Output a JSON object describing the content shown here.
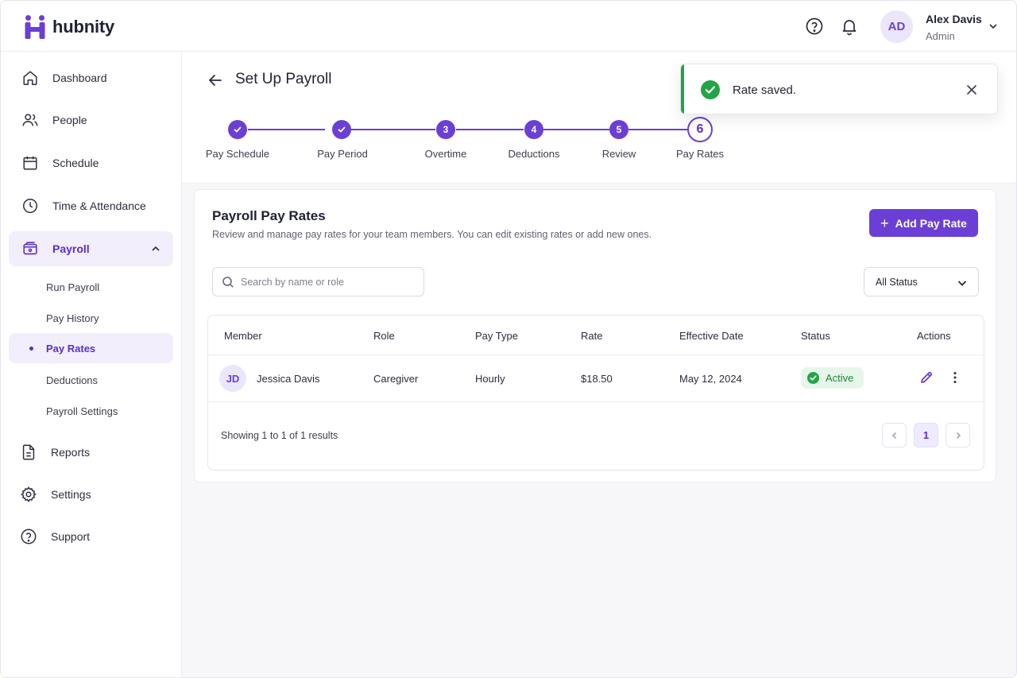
{
  "app": {
    "name": "hubnity",
    "brand_color": "#6b3fd6"
  },
  "header": {
    "help_icon": "help-circle-icon",
    "notification_icon": "bell-icon",
    "user": {
      "initials": "AD",
      "name": "Alex Davis",
      "role": "Admin"
    }
  },
  "sidebar": {
    "items": [
      {
        "label": "Dashboard",
        "icon": "home-icon"
      },
      {
        "label": "People",
        "icon": "users-icon"
      },
      {
        "label": "Schedule",
        "icon": "calendar-icon"
      },
      {
        "label": "Time & Attendance",
        "icon": "clock-icon"
      },
      {
        "label": "Payroll",
        "icon": "wallet-icon",
        "active": true,
        "expanded": true
      },
      {
        "label": "Reports",
        "icon": "document-icon"
      },
      {
        "label": "Settings",
        "icon": "gear-icon"
      },
      {
        "label": "Support",
        "icon": "help-circle-icon"
      }
    ],
    "payroll_sub": [
      {
        "label": "Run Payroll"
      },
      {
        "label": "Pay History"
      },
      {
        "label": "Pay Rates",
        "active": true
      },
      {
        "label": "Deductions"
      },
      {
        "label": "Payroll Settings"
      }
    ]
  },
  "page": {
    "title": "Set Up Payroll",
    "steps": [
      {
        "label": "Pay Schedule",
        "state": "done"
      },
      {
        "label": "Pay Period",
        "state": "done"
      },
      {
        "label": "Overtime",
        "number": "3",
        "state": "upcoming"
      },
      {
        "label": "Deductions",
        "number": "4",
        "state": "upcoming"
      },
      {
        "label": "Review",
        "number": "5",
        "state": "upcoming"
      },
      {
        "label": "Pay Rates",
        "number": "6",
        "state": "current"
      }
    ]
  },
  "card": {
    "title": "Payroll Pay Rates",
    "subtitle": "Review and manage pay rates for your team members. You can edit existing rates or add new ones.",
    "add_button": "Add Pay Rate",
    "search_placeholder": "Search by name or role",
    "status_filter": "All Status"
  },
  "table": {
    "columns": [
      "Member",
      "Role",
      "Pay Type",
      "Rate",
      "Effective Date",
      "Status",
      "Actions"
    ],
    "rows": [
      {
        "initials": "JD",
        "member": "Jessica Davis",
        "role": "Caregiver",
        "pay_type": "Hourly",
        "rate": "$18.50",
        "effective_date": "May 12, 2024",
        "status": "Active"
      }
    ],
    "showing": "Showing 1 to 1 of 1 results",
    "current_page": "1"
  },
  "toast": {
    "message": "Rate saved.",
    "status_color": "#22a447"
  }
}
